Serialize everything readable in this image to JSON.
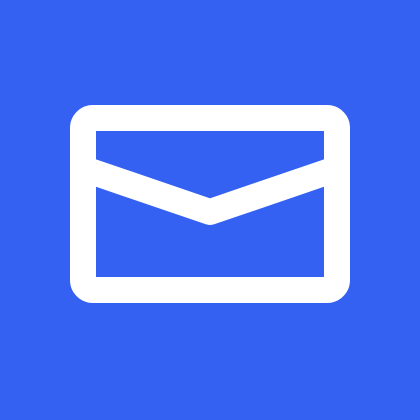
{
  "icon": {
    "name": "mail-icon",
    "background_color": "#3461F2",
    "glyph_color": "#FFFFFF"
  }
}
